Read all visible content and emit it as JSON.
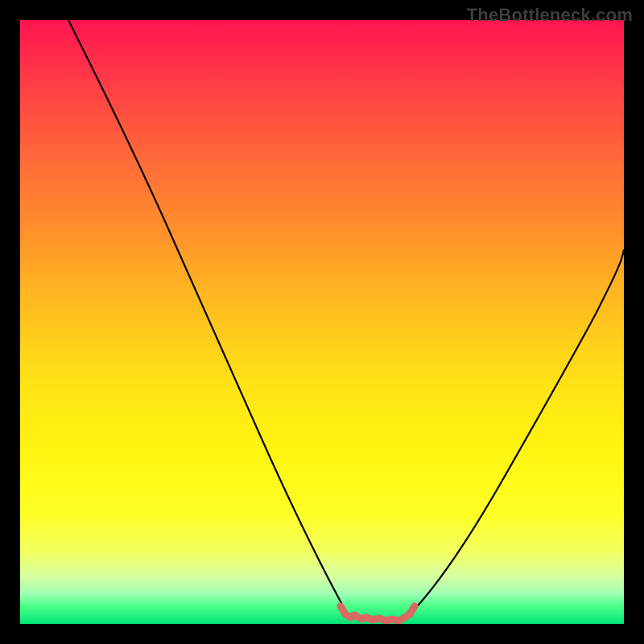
{
  "watermark": "TheBottleneck.com",
  "chart_data": {
    "type": "line",
    "title": "",
    "xlabel": "",
    "ylabel": "",
    "xlim": [
      0,
      100
    ],
    "ylim": [
      0,
      100
    ],
    "grid": false,
    "legend": false,
    "series": [
      {
        "name": "curve-left",
        "color": "#000000",
        "x": [
          8,
          12,
          18,
          24,
          30,
          36,
          42,
          46,
          50,
          52,
          54
        ],
        "values": [
          100,
          92,
          82,
          71,
          59,
          46,
          32,
          21,
          10,
          5,
          2
        ]
      },
      {
        "name": "curve-right",
        "color": "#000000",
        "x": [
          65,
          68,
          72,
          76,
          80,
          84,
          88,
          92,
          96,
          100
        ],
        "values": [
          2,
          5,
          11,
          18,
          26,
          34,
          42,
          49,
          56,
          62
        ]
      },
      {
        "name": "floor-segment",
        "color": "#d86a63",
        "x": [
          52,
          54,
          56,
          58,
          60,
          62,
          64,
          65
        ],
        "values": [
          2,
          0.5,
          0.2,
          0.2,
          0.2,
          0.3,
          0.8,
          2
        ]
      }
    ],
    "gradient_stops": [
      {
        "pos": 0,
        "color": "#ff1450"
      },
      {
        "pos": 50,
        "color": "#ffd11a"
      },
      {
        "pos": 88,
        "color": "#f2ff5f"
      },
      {
        "pos": 100,
        "color": "#00e676"
      }
    ]
  }
}
